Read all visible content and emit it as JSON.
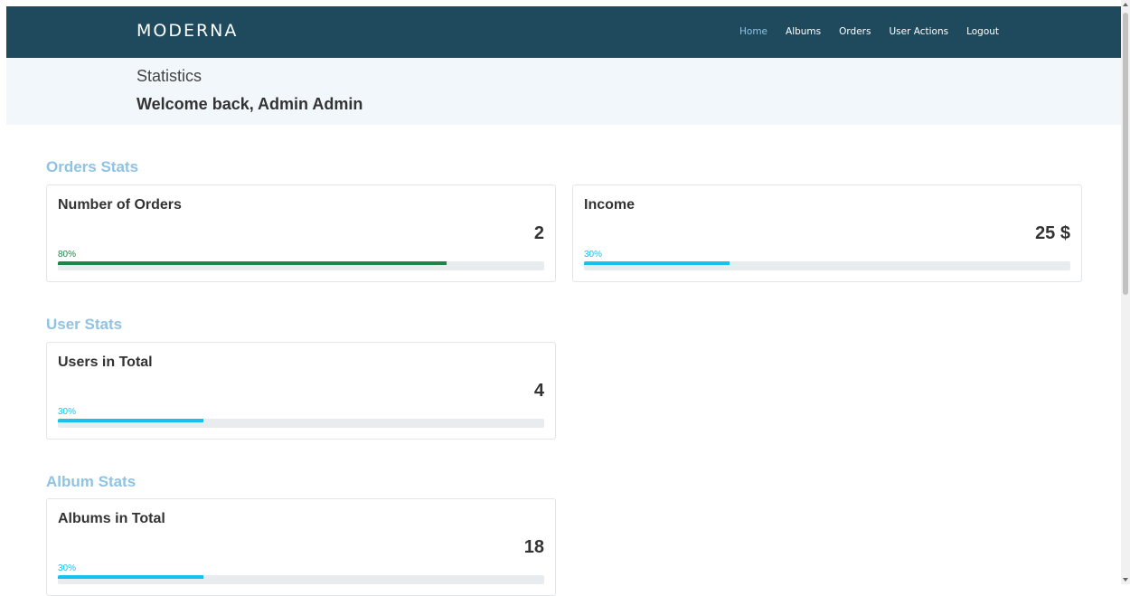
{
  "brand": "MODERNA",
  "nav": [
    {
      "label": "Home",
      "active": true
    },
    {
      "label": "Albums",
      "active": false
    },
    {
      "label": "Orders",
      "active": false
    },
    {
      "label": "User Actions",
      "active": false
    },
    {
      "label": "Logout",
      "active": false
    }
  ],
  "header": {
    "title": "Statistics",
    "welcome": "Welcome back, Admin Admin"
  },
  "sections": {
    "orders": {
      "title": "Orders Stats",
      "cards": [
        {
          "title": "Number of Orders",
          "value": "2",
          "progress_label": "80%",
          "progress": 80,
          "color": "#1e8449"
        },
        {
          "title": "Income",
          "value": "25 $",
          "progress_label": "30%",
          "progress": 30,
          "color": "#17c1ee"
        }
      ]
    },
    "users": {
      "title": "User Stats",
      "cards": [
        {
          "title": "Users in Total",
          "value": "4",
          "progress_label": "30%",
          "progress": 30,
          "color": "#17c1ee"
        }
      ]
    },
    "albums": {
      "title": "Album Stats",
      "cards": [
        {
          "title": "Albums in Total",
          "value": "18",
          "progress_label": "30%",
          "progress": 30,
          "color": "#17c1ee"
        }
      ]
    }
  },
  "colors": {
    "navbar": "#1f4a5d",
    "subheader": "#f1f7fa",
    "accent": "#8fc3e3",
    "success": "#1e8449",
    "info": "#17c1ee"
  }
}
